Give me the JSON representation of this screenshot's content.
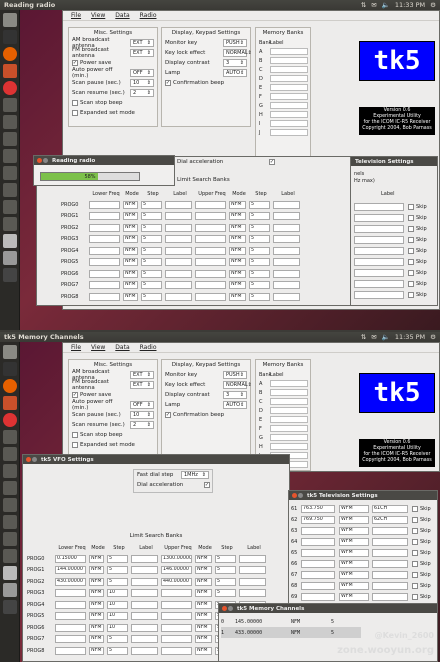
{
  "top": {
    "panel_title": "Reading radio",
    "clock": "11:33 PM",
    "menu": [
      "File",
      "View",
      "Data",
      "Radio"
    ],
    "misc": {
      "title": "Misc. Settings",
      "rows": [
        {
          "label": "AM broadcast antenna",
          "value": "EXT"
        },
        {
          "label": "FM broadcast antenna",
          "value": "EXT"
        },
        {
          "label": "Power save",
          "check": "✓"
        },
        {
          "label": "Auto power off (min.)",
          "value": "OFF"
        },
        {
          "label": "Scan pause (sec.)",
          "value": "10"
        },
        {
          "label": "Scan resume (sec.)",
          "value": "2"
        },
        {
          "label": "Scan stop beep",
          "check": ""
        },
        {
          "label": "Expanded set mode",
          "check": ""
        }
      ]
    },
    "display": {
      "title": "Display, Keypad Settings",
      "rows": [
        {
          "label": "Monitor key",
          "value": "PUSH"
        },
        {
          "label": "Key lock effect",
          "value": "NORMAL"
        },
        {
          "label": "Display contrast",
          "value": "3"
        },
        {
          "label": "Lamp",
          "value": "AUTO"
        },
        {
          "label": "Confirmation beep",
          "check": "✓"
        }
      ]
    },
    "memory": {
      "title": "Memory Banks",
      "col1": "Bank",
      "col2": "Label",
      "banks": [
        "A",
        "B",
        "C",
        "D",
        "E",
        "F",
        "G",
        "H",
        "I",
        "J"
      ]
    },
    "logo": "tk5",
    "about": [
      "Version 0.6",
      "Experimental Utility",
      "for the ICOM IC-R5 Receiver",
      "Copyright 2004, Bob Parnass"
    ],
    "progress": {
      "title": "Reading radio",
      "text": "58%",
      "value": 0.58
    },
    "dial_accel": "Dial acceleration",
    "limit": "Limit Search Banks",
    "tv_title": "Television Settings",
    "tv_hint": "nels",
    "tv_hint2": "Hz max)",
    "scan_headers": [
      "Lower Freq",
      "Mode",
      "Step",
      "Label",
      "Upper Freq",
      "Mode",
      "Step",
      "Label"
    ],
    "tv_headers": [
      "Label"
    ],
    "progs": [
      "PROG0",
      "PROG1",
      "PROG2",
      "PROG3",
      "PROG4",
      "PROG5",
      "PROG6",
      "PROG7",
      "PROG8"
    ],
    "mode": "NFM",
    "step": "5",
    "skip": "Skip"
  },
  "bottom": {
    "panel_title": "tk5 Memory Channels",
    "clock": "11:35 PM",
    "menu": [
      "File",
      "View",
      "Data",
      "Radio"
    ],
    "misc": {
      "title": "Misc. Settings",
      "rows": [
        {
          "label": "AM broadcast antenna",
          "value": "EXT"
        },
        {
          "label": "FM broadcast antenna",
          "value": "EXT"
        },
        {
          "label": "Power save",
          "check": "✓"
        },
        {
          "label": "Auto power off (min.)",
          "value": "OFF"
        },
        {
          "label": "Scan pause (sec.)",
          "value": "10"
        },
        {
          "label": "Scan resume (sec.)",
          "value": "2"
        },
        {
          "label": "Scan stop beep",
          "check": ""
        },
        {
          "label": "Expanded set mode",
          "check": ""
        }
      ]
    },
    "display": {
      "title": "Display, Keypad Settings",
      "rows": [
        {
          "label": "Monitor key",
          "value": "PUSH"
        },
        {
          "label": "Key lock effect",
          "value": "NORMAL"
        },
        {
          "label": "Display contrast",
          "value": "3"
        },
        {
          "label": "Lamp",
          "value": "AUTO"
        },
        {
          "label": "Confirmation beep",
          "check": "✓"
        }
      ]
    },
    "memory": {
      "title": "Memory Banks",
      "col1": "Bank",
      "col2": "Label",
      "banks": [
        "A",
        "B",
        "C",
        "D",
        "E",
        "F",
        "G",
        "H",
        "I",
        "J"
      ]
    },
    "logo": "tk5",
    "about": [
      "Version 0.6",
      "Experimental Utility",
      "for the ICOM IC-R5 Receiver",
      "Copyright 2004, Bob Parnass"
    ],
    "vfo": {
      "title": "tk5 VFO Settings",
      "fast_dial": "Fast dial step",
      "fast_val": "1MHz",
      "dial_accel": "Dial acceleration",
      "limit": "Limit Search Banks",
      "headers": [
        "Lower Freq",
        "Mode",
        "Step",
        "Label",
        "Upper Freq",
        "Mode",
        "Step",
        "Label"
      ],
      "rows": [
        {
          "p": "PROG0",
          "lo": "0.15000",
          "hi": "1300.00000"
        },
        {
          "p": "PROG1",
          "lo": "144.00000",
          "hi": "146.00000"
        },
        {
          "p": "PROG2",
          "lo": "430.00000",
          "hi": "440.00000"
        },
        {
          "p": "PROG3",
          "lo": "",
          "hi": ""
        },
        {
          "p": "PROG4",
          "lo": "",
          "hi": ""
        },
        {
          "p": "PROG5",
          "lo": "",
          "hi": ""
        },
        {
          "p": "PROG6",
          "lo": "",
          "hi": ""
        },
        {
          "p": "PROG7",
          "lo": "",
          "hi": ""
        },
        {
          "p": "PROG8",
          "lo": "",
          "hi": ""
        }
      ],
      "mode": "NFM",
      "step": "5",
      "step10": "10"
    },
    "tv": {
      "title": "tk5 Television Settings",
      "rows": [
        {
          "n": "61",
          "f": "763.750",
          "m": "WFM",
          "l": "61CH"
        },
        {
          "n": "62",
          "f": "769.750",
          "m": "WFM",
          "l": "62CH"
        },
        {
          "n": "63",
          "f": "",
          "m": "WFM",
          "l": ""
        },
        {
          "n": "64",
          "f": "",
          "m": "WFM",
          "l": ""
        },
        {
          "n": "65",
          "f": "",
          "m": "WFM",
          "l": ""
        },
        {
          "n": "66",
          "f": "",
          "m": "WFM",
          "l": ""
        },
        {
          "n": "67",
          "f": "",
          "m": "WFM",
          "l": ""
        },
        {
          "n": "68",
          "f": "",
          "m": "WFM",
          "l": ""
        },
        {
          "n": "69",
          "f": "",
          "m": "WFM",
          "l": ""
        }
      ],
      "skip": "Skip"
    },
    "memch": {
      "title": "tk5 Memory Channels",
      "rows": [
        {
          "n": "0",
          "f": "145.00000",
          "m": "NFM",
          "s": "5"
        },
        {
          "n": "1",
          "f": "433.00000",
          "m": "NFM",
          "s": "5"
        }
      ]
    },
    "watermark1": "@Kevin_2600",
    "watermark2": "zone.wooyun.org"
  }
}
